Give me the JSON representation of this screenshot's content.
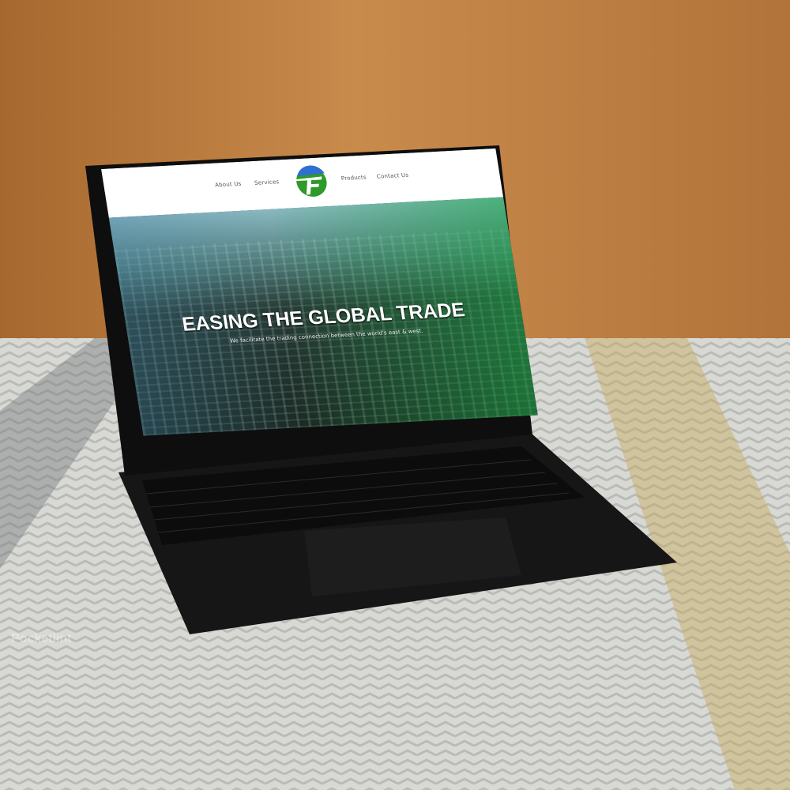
{
  "website": {
    "nav": [
      "About Us",
      "Services",
      "Products",
      "Contact Us"
    ],
    "logo_letter": "F",
    "hero_title": "EASING THE GLOBAL TRADE",
    "hero_subtitle": "We facilitate the trading connection between the world's east & west."
  },
  "watermark": "Pocketlint",
  "colors": {
    "logo_blue": "#2f6fd0",
    "logo_green": "#2e9a2a",
    "wood": "#b97a3e",
    "rug": "#d9dad6"
  }
}
